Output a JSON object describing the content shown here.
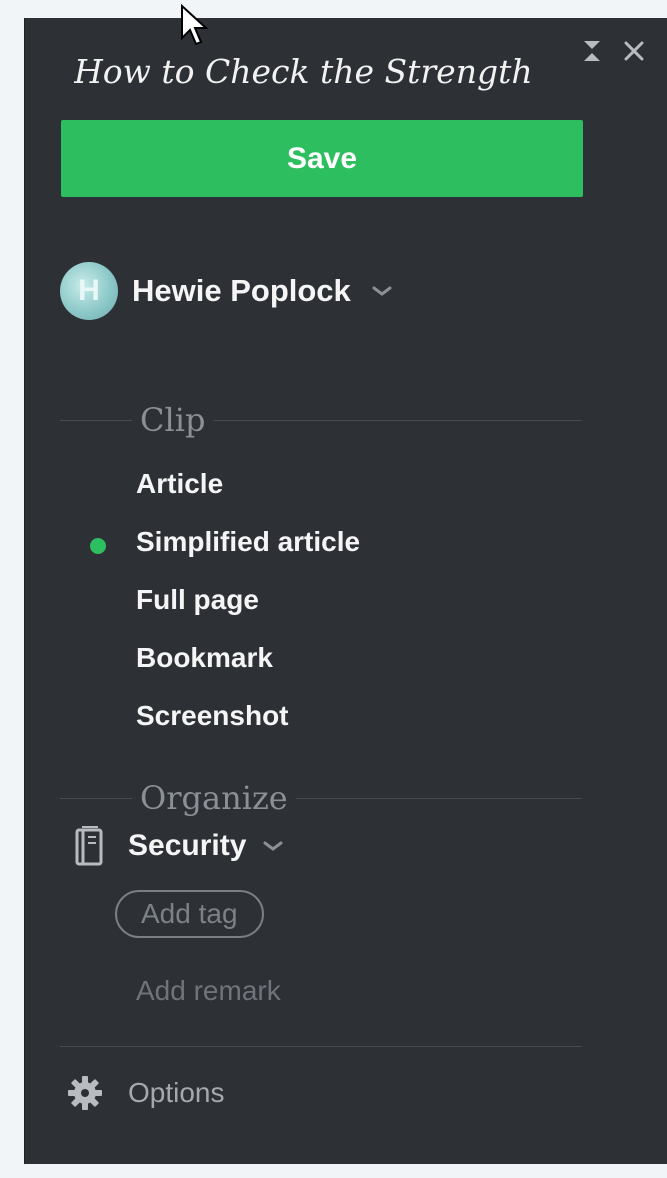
{
  "clipper": {
    "title": "How to Check the Strength",
    "save_label": "Save",
    "user": {
      "initial": "H",
      "name": "Hewie Poplock"
    },
    "clip": {
      "heading": "Clip",
      "options": [
        "Article",
        "Simplified article",
        "Full page",
        "Bookmark",
        "Screenshot"
      ],
      "selected": "Simplified article"
    },
    "organize": {
      "heading": "Organize",
      "notebook": "Security",
      "add_tag_label": "Add tag",
      "add_remark_label": "Add remark"
    },
    "options_label": "Options"
  },
  "colors": {
    "panel_bg": "#2d3136",
    "accent_green": "#2dbe60"
  },
  "icons": [
    "cursor-arrow-icon",
    "collapse-icon",
    "close-icon",
    "chevron-down-icon",
    "notebook-icon",
    "gear-icon"
  ]
}
